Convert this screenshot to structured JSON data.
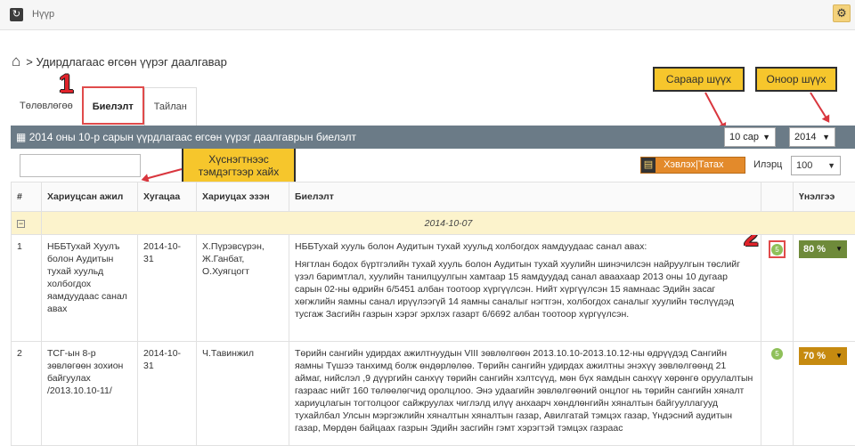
{
  "topbar": {
    "home_label": "Нүүр",
    "reload_icon": "↻",
    "gear_icon": "⚙"
  },
  "breadcrumb": {
    "home_icon": "⌂",
    "current": "> Удирдлагаас өгсөн үүрэг даалгавар"
  },
  "tabs": [
    "Төлөвлөгөө",
    "Биелэлт",
    "Тайлан"
  ],
  "panel": {
    "title": "2014 оны 10-р сарын үүрдлагаас өгсөн үүрэг даалгаврын биелэлт",
    "calendar_icon": "▦",
    "month_select": "10 сар",
    "year_select": "2014"
  },
  "toolbar": {
    "search_value": "",
    "export_label": "Хэвлэх|Татах",
    "export_icon": "▤",
    "per_page_label": "Илэрц",
    "per_page_value": "100"
  },
  "annotations": {
    "month_filter": "Сараар шүүх",
    "year_filter": "Оноор шүүх",
    "search_hint_line1": "Хүснэгтнээс",
    "search_hint_line2": "тэмдэгтээр хайх",
    "marker_1": "1",
    "marker_2": "2"
  },
  "table": {
    "headers": [
      "#",
      "Хариуцсан ажил",
      "Хугацаа",
      "Хариуцах эзэн",
      "Биелэлт",
      "",
      "Үнэлгээ"
    ],
    "group_toggle": "−",
    "group_date": "2014-10-07",
    "rows": [
      {
        "num": "1",
        "task": "НББТухай Хуулъ болон Аудитын тухай хуульд холбогдох яамдуудаас санал авах",
        "deadline": "2014-10-31",
        "owner": "Х.Пүрэвсүрэн, Ж.Ганбат, О.Хуягцогт",
        "report_p1": "НББТухай хууль болон Аудитын тухай хуульд холбогдох яамдуудаас санал авах:",
        "report_p2": "Нягтлан бодох бүртгэлийн тухай хууль болон Аудитын тухай хуулийн шинэчилсэн найруулгын төслийг үзэл баримтлал, хуулийн танилцуулгын хамтаар 15 яамдуудад санал аваахаар 2013 оны 10 дугаар сарын 02-ны өдрийн 6/5451 албан тоотоор хүргүүлсэн. Нийт хүргүүлсэн 15 яамнаас Эдийн засаг хөгжлийн яамны санал ирүүлээгүй 14 яамны саналыг нэгтгэн, холбогдох саналыг хуулийн төслүүдэд тусгаж Засгийн газрын хэрэг эрхлэх газарт 6/6692 албан тоотоор хүргүүлсэн.",
        "comments": "5",
        "rating": "80 %",
        "rating_color": "#6e8a3a"
      },
      {
        "num": "2",
        "task": "ТСГ-ын 8-р зөвлөгөөн зохион байгуулах /2013.10.10-11/",
        "deadline": "2014-10-31",
        "owner": "Ч.Тавинжил",
        "report_p1": "Төрийн сангийн удирдах ажилтнуудын VIII зөвлөлгөөн 2013.10.10-2013.10.12-ны өдрүүдэд Сангийн яамны Түшээ танхимд болж өндөрлөлөө. Төрийн сангийн удирдах ажилтны энэхүү зөвлөлгөөнд 21 аймаг, нийслэл ,9 дүүргийн санхүү төрийн сангийн хэлтсүүд, мөн бүх яамдын санхүү хөрөнгө оруулалтын газраас нийт 160 төлөөлөгчид оролцлоо. Энэ удаагийн зөвлөлгөөний онцлог нь төрийн сангийн хяналт хариуцлагын тогтолцоог сайжруулах чиглэлд илүү анхаарч хөндлөнгийн хяналтын байгууллагууд тухайлбал Улсын мэргэжлийн хяналтын хяналтын газар, Авилгатай тэмцэх газар, Үндэсний аудитын газар, Мөрдөн байцаах газрын Эдийн засгийн гэмт хэрэгтэй тэмцэх газраас",
        "report_p2": "",
        "comments": "5",
        "rating": "70 %",
        "rating_color": "#c68a10"
      }
    ]
  },
  "colors": {
    "panel_header": "#6b7b87",
    "callout": "#f6c62c",
    "annotation_red": "#e0232b",
    "export_button": "#e38a2b",
    "group_row": "#fcf3cc"
  }
}
